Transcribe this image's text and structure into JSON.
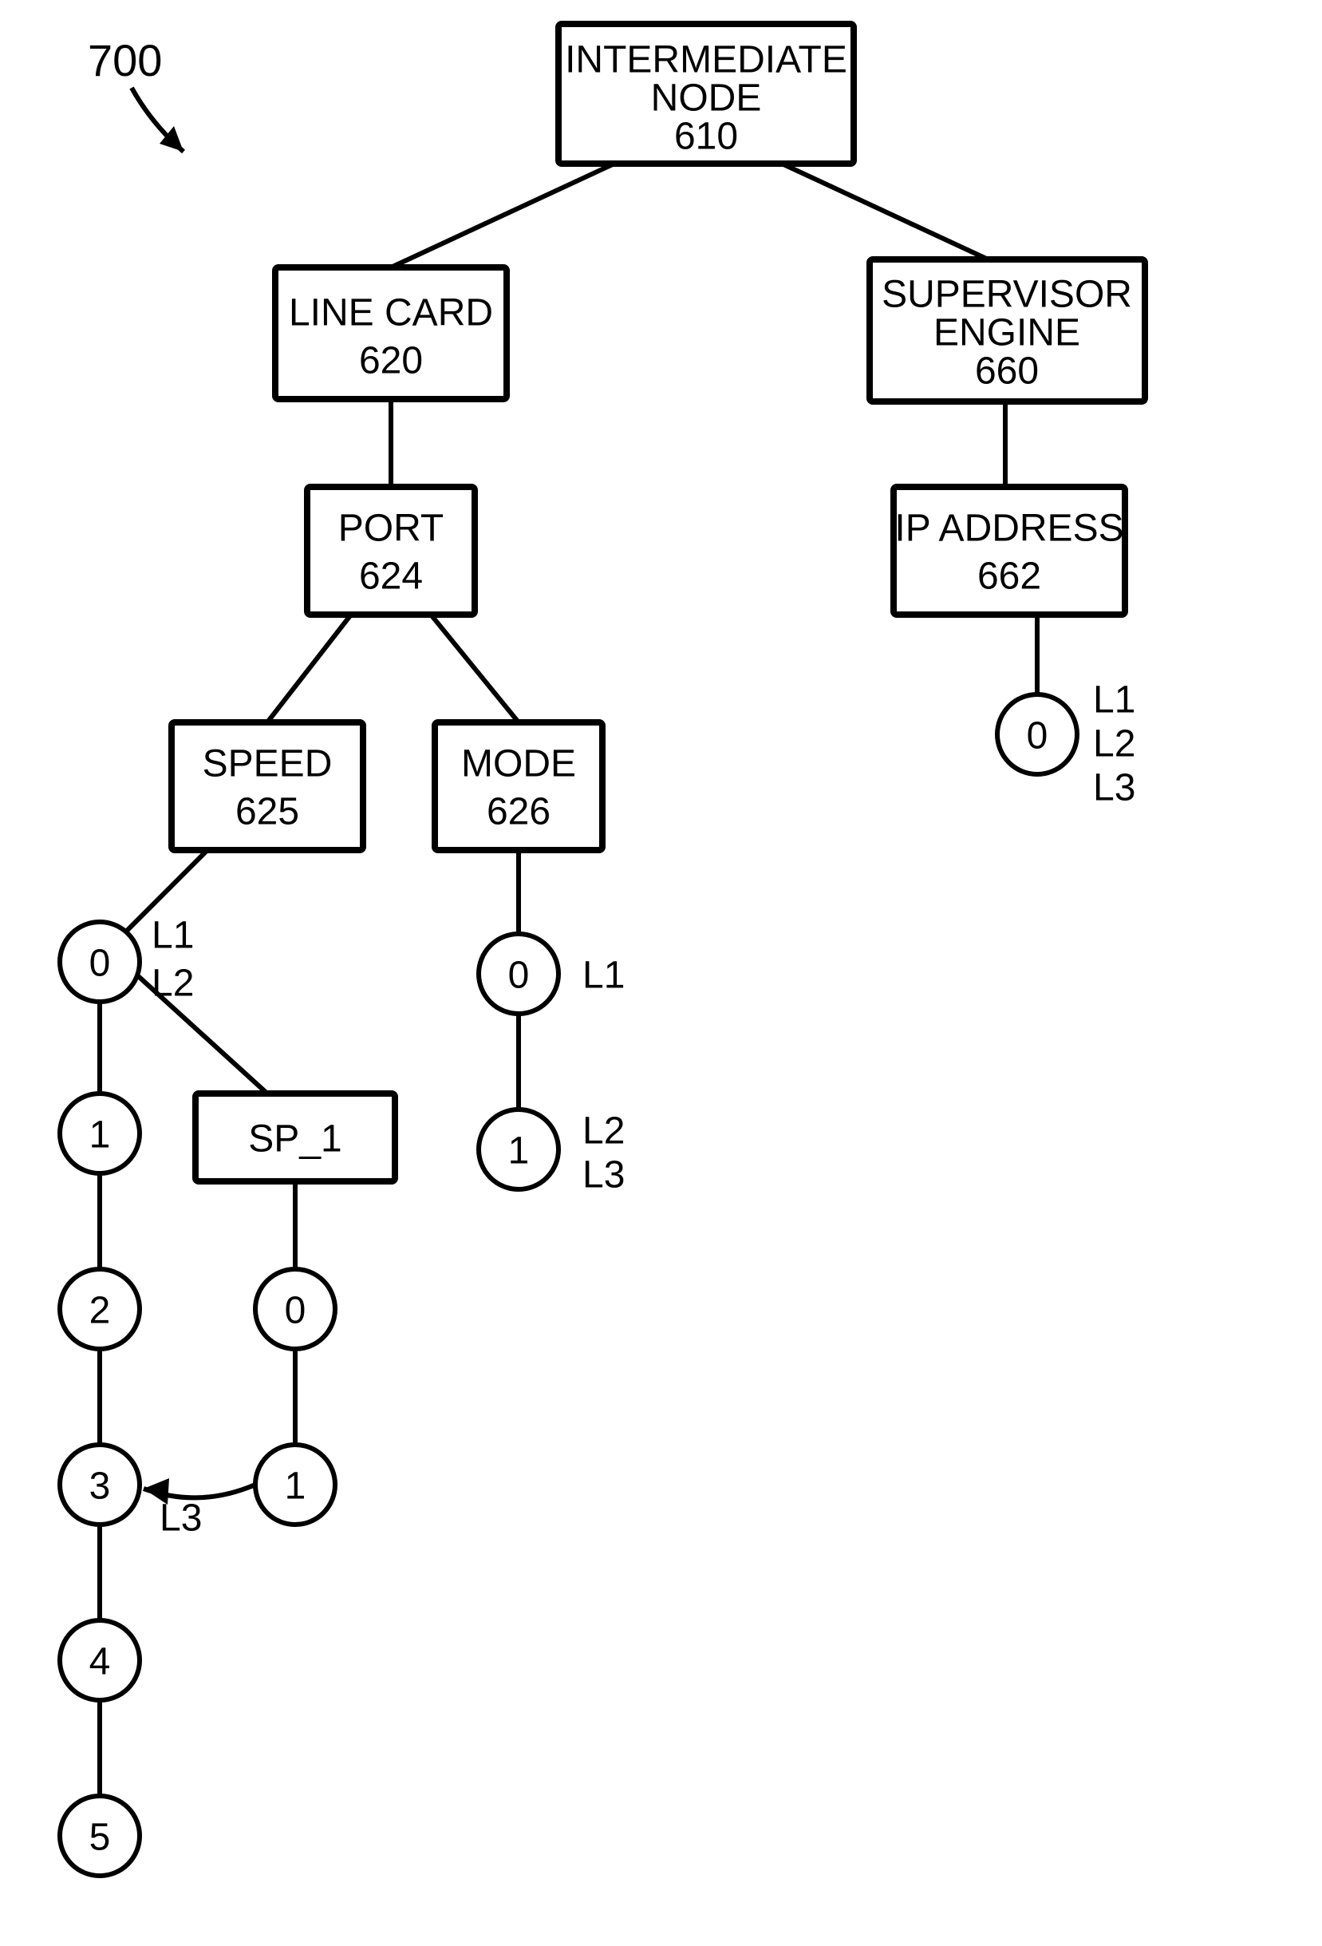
{
  "figure_label": "700",
  "boxes": {
    "root": {
      "line1": "INTERMEDIATE",
      "line2": "NODE",
      "num": "610"
    },
    "lc": {
      "line1": "LINE CARD",
      "num": "620"
    },
    "sup": {
      "line1": "SUPERVISOR",
      "line2": "ENGINE",
      "num": "660"
    },
    "port": {
      "line1": "PORT",
      "num": "624"
    },
    "ip": {
      "line1": "IP ADDRESS",
      "num": "662"
    },
    "speed": {
      "line1": "SPEED",
      "num": "625"
    },
    "mode": {
      "line1": "MODE",
      "num": "626"
    },
    "sp1": {
      "line1": "SP_1"
    }
  },
  "nodes": {
    "speed_chain": [
      "0",
      "1",
      "2",
      "3",
      "4",
      "5"
    ],
    "sp1_chain": [
      "0",
      "1"
    ],
    "mode_chain": [
      "0",
      "1"
    ],
    "ip_chain": [
      "0"
    ]
  },
  "labels": {
    "speed0_l1": "L1",
    "speed0_l2": "L2",
    "sp1_arrow": "L3",
    "mode0": "L1",
    "mode1_l2": "L2",
    "mode1_l3": "L3",
    "ip0_l1": "L1",
    "ip0_l2": "L2",
    "ip0_l3": "L3"
  }
}
